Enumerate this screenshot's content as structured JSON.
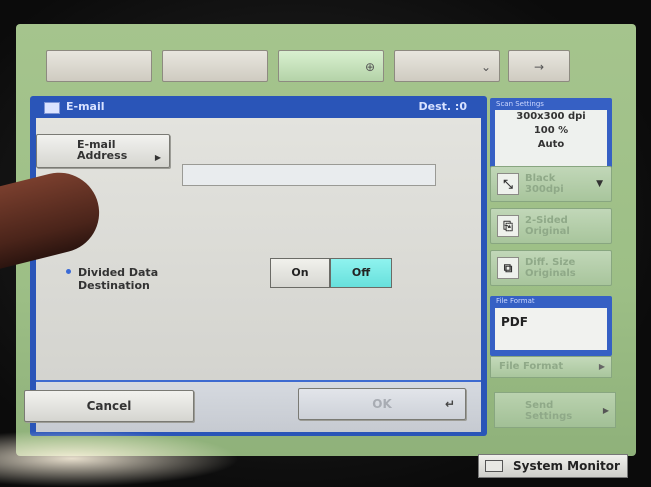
{
  "panel": {
    "title": "E-mail",
    "dest": "Dest. :0"
  },
  "email_address_button": {
    "line1": "E-mail",
    "line2": "Address"
  },
  "email_address_field": {
    "value": ""
  },
  "divided_data": {
    "line1": "Divided Data",
    "line2": "Destination",
    "on_label": "On",
    "off_label": "Off",
    "selected": "Off"
  },
  "footer": {
    "cancel_label": "Cancel",
    "ok_label": "OK"
  },
  "scan_settings": {
    "header": "Scan Settings",
    "resolution": "300x300 dpi",
    "zoom": "100 %",
    "mode": "Auto"
  },
  "right_buttons": {
    "color_line1": "Black",
    "color_line2": "300dpi",
    "sided_line1": "2-Sided",
    "sided_line2": "Original",
    "diff_line1": "Diff. Size",
    "diff_line2": "Originals"
  },
  "file_format": {
    "header": "File Format",
    "value": "PDF",
    "button_label": "File Format"
  },
  "send_settings": {
    "line1": "Send",
    "line2": "Settings"
  },
  "system_monitor": {
    "label": "System Monitor"
  },
  "colors": {
    "panel_blue": "#2a55b8",
    "selected_cyan": "#67e0dc",
    "screen_green": "#9dbf86"
  }
}
